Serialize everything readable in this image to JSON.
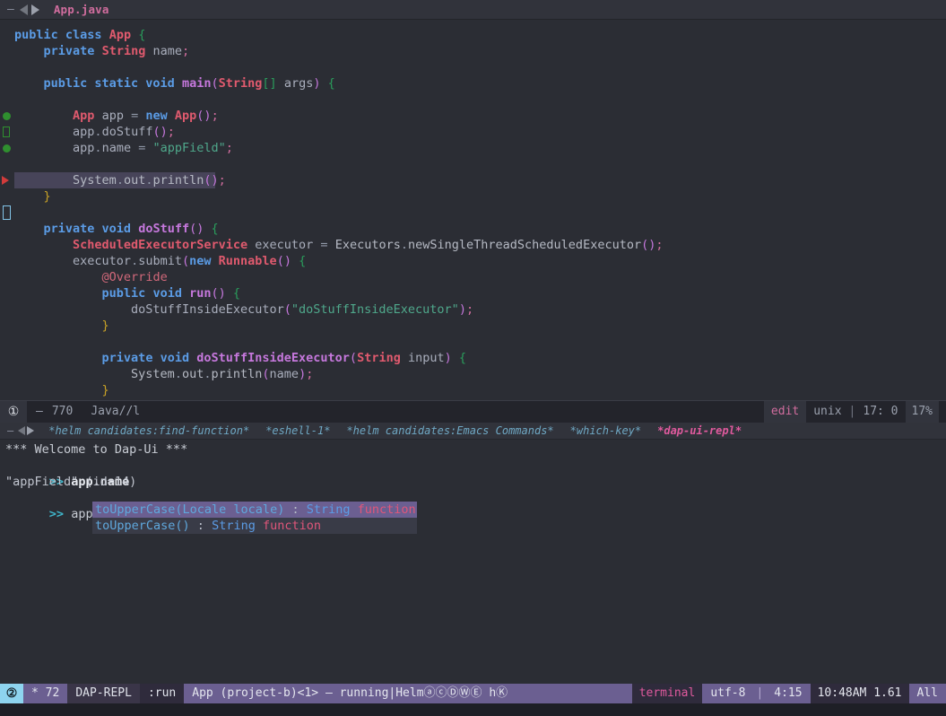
{
  "editor_tabbar": {
    "dash": "—",
    "prev_icon": "triangle-left-icon",
    "next_icon": "triangle-right-icon",
    "title": "App.java"
  },
  "code": {
    "language": "java",
    "lines": [
      {
        "marker": "",
        "indent": 0,
        "html": "<span class='kw'>public class</span> <span class='type'>App</span> <span class='brc'>{</span>"
      },
      {
        "marker": "",
        "indent": 0,
        "html": "    <span class='kw'>private</span> <span class='type'>String</span> <span class='var'>name</span><span class='semi'>;</span>"
      },
      {
        "marker": "",
        "indent": 0,
        "html": ""
      },
      {
        "marker": "",
        "indent": 0,
        "html": "    <span class='kw'>public static void</span> <span class='fn'>main</span><span class='brp'>(</span><span class='type'>String</span><span class='brc'>[]</span> <span class='var'>args</span><span class='brp'>)</span> <span class='brc'>{</span>"
      },
      {
        "marker": "",
        "indent": 0,
        "html": ""
      },
      {
        "marker": "breakpoint-dot",
        "indent": 0,
        "html": "        <span class='type'>App</span> <span class='var'>app</span> <span class='punc'>=</span> <span class='kw'>new</span> <span class='type'>App</span><span class='brp'>()</span><span class='semi'>;</span>"
      },
      {
        "marker": "breakpoint-square",
        "indent": 0,
        "html": "        <span class='var'>app</span><span class='punc'>.</span><span class='var'>doStuff</span><span class='brp'>()</span><span class='semi'>;</span>"
      },
      {
        "marker": "breakpoint-dot",
        "indent": 0,
        "html": "        <span class='var'>app</span><span class='punc'>.</span><span class='var'>name</span> <span class='punc'>=</span> <span class='str'>\"appField\"</span><span class='semi'>;</span>"
      },
      {
        "marker": "",
        "indent": 0,
        "html": ""
      },
      {
        "marker": "exec-arrow",
        "highlight": true,
        "hlwidth": 224,
        "indent": 0,
        "html": "        <span class='plain'>System</span><span class='punc'>.</span><span class='plain'>out</span><span class='punc'>.</span><span class='plain'>println</span><span class='brp'>()</span><span class='semi'>;</span>"
      },
      {
        "marker": "",
        "indent": 0,
        "html": "    <span class='brcy'>}</span>"
      },
      {
        "marker": "logpoint-box",
        "indent": 0,
        "html": ""
      },
      {
        "marker": "",
        "indent": 0,
        "html": "    <span class='kw'>private void</span> <span class='fn'>doStuff</span><span class='brp'>()</span> <span class='brc'>{</span>"
      },
      {
        "marker": "",
        "indent": 0,
        "html": "        <span class='type'>ScheduledExecutorService</span> <span class='var'>executor</span> <span class='punc'>=</span> <span class='plain'>Executors</span><span class='punc'>.</span><span class='plain'>newSingleThreadScheduledExecutor</span><span class='brp'>()</span><span class='semi'>;</span>"
      },
      {
        "marker": "",
        "indent": 0,
        "html": "        <span class='var'>executor</span><span class='punc'>.</span><span class='var'>submit</span><span class='brp'>(</span><span class='kw'>new</span> <span class='type'>Runnable</span><span class='brp'>()</span> <span class='brc'>{</span>"
      },
      {
        "marker": "",
        "indent": 0,
        "html": "            <span class='ann'>@Override</span>"
      },
      {
        "marker": "",
        "indent": 0,
        "html": "            <span class='kw'>public void</span> <span class='fn'>run</span><span class='brp'>()</span> <span class='brc'>{</span>"
      },
      {
        "marker": "",
        "indent": 0,
        "html": "                <span class='var'>doStuffInsideExecutor</span><span class='brp'>(</span><span class='str'>\"doStuffInsideExecutor\"</span><span class='brp'>)</span><span class='semi'>;</span>"
      },
      {
        "marker": "",
        "indent": 0,
        "html": "            <span class='brcy'>}</span>"
      },
      {
        "marker": "",
        "indent": 0,
        "html": ""
      },
      {
        "marker": "",
        "indent": 0,
        "html": "            <span class='kw'>private void</span> <span class='fn'>doStuffInsideExecutor</span><span class='brp'>(</span><span class='type'>String</span> <span class='var'>input</span><span class='brp'>)</span> <span class='brc'>{</span>"
      },
      {
        "marker": "",
        "indent": 0,
        "html": "                <span class='plain'>System</span><span class='punc'>.</span><span class='plain'>out</span><span class='punc'>.</span><span class='plain'>println</span><span class='brp'>(</span><span class='var'>name</span><span class='brp'>)</span><span class='semi'>;</span>"
      },
      {
        "marker": "",
        "indent": 0,
        "html": "            <span class='brcy'>}</span>"
      }
    ]
  },
  "modeline": {
    "window_number": "①",
    "modified": "–",
    "size": "770",
    "mode": "Java//l",
    "state": "edit",
    "encoding": "unix",
    "separator": "|",
    "position": "17: 0",
    "percent": "17%"
  },
  "repl_tabbar": {
    "dash": "—",
    "prev_icon": "triangle-left-icon",
    "next_icon": "triangle-right-icon",
    "tabs": [
      {
        "label": "*helm candidates:find-function*",
        "active": false
      },
      {
        "label": "*eshell-1*",
        "active": false
      },
      {
        "label": "*helm candidates:Emacs Commands*",
        "active": false
      },
      {
        "label": "*which-key*",
        "active": false
      },
      {
        "label": "*dap-ui-repl*",
        "active": true
      }
    ]
  },
  "repl": {
    "welcome": "*** Welcome to Dap-Ui ***",
    "prompt": ">>",
    "entry1_input": "app.name",
    "entry1_output": "\"appField\" (id=14)",
    "entry2_input": "app.name.toU",
    "completions": [
      {
        "name": "toUpperCase(Locale locale)",
        "colon": " : ",
        "type": "String",
        "kind": "function",
        "selected": true
      },
      {
        "name": "toUpperCase()",
        "colon": " : ",
        "type": "String",
        "kind": "function",
        "selected": false
      }
    ]
  },
  "statusbar": {
    "window_number": "②",
    "modified_marker": "*",
    "buffer_size": "72",
    "major_mode": "DAP-REPL",
    "run_state": ":run",
    "session": "App (project-b)<1> – running|HelmⓐⓒⒹⓌⒺ hⓀ",
    "terminal": "terminal",
    "encoding": "utf-8",
    "separator": "|",
    "position": "4:15",
    "clock": "10:48AM 1.61",
    "scroll": "All"
  },
  "colors": {
    "background": "#2b2d34",
    "tabbar_bg": "#31333b",
    "modeline_bg": "#23242b",
    "statusbar_bg": "#6b5f91",
    "accent_pink": "#e05a9e",
    "keyword_blue": "#5b9ce6",
    "type_red": "#e05a6e",
    "string_green": "#4fa88b",
    "breakpoint_green": "#2f8f2f",
    "exec_arrow_red": "#d13b3b",
    "highlight_line": "#474459",
    "popup_bg": "#393b47",
    "popup_sel": "#6b5f91",
    "window_badge_cyan": "#8ed4ef"
  }
}
